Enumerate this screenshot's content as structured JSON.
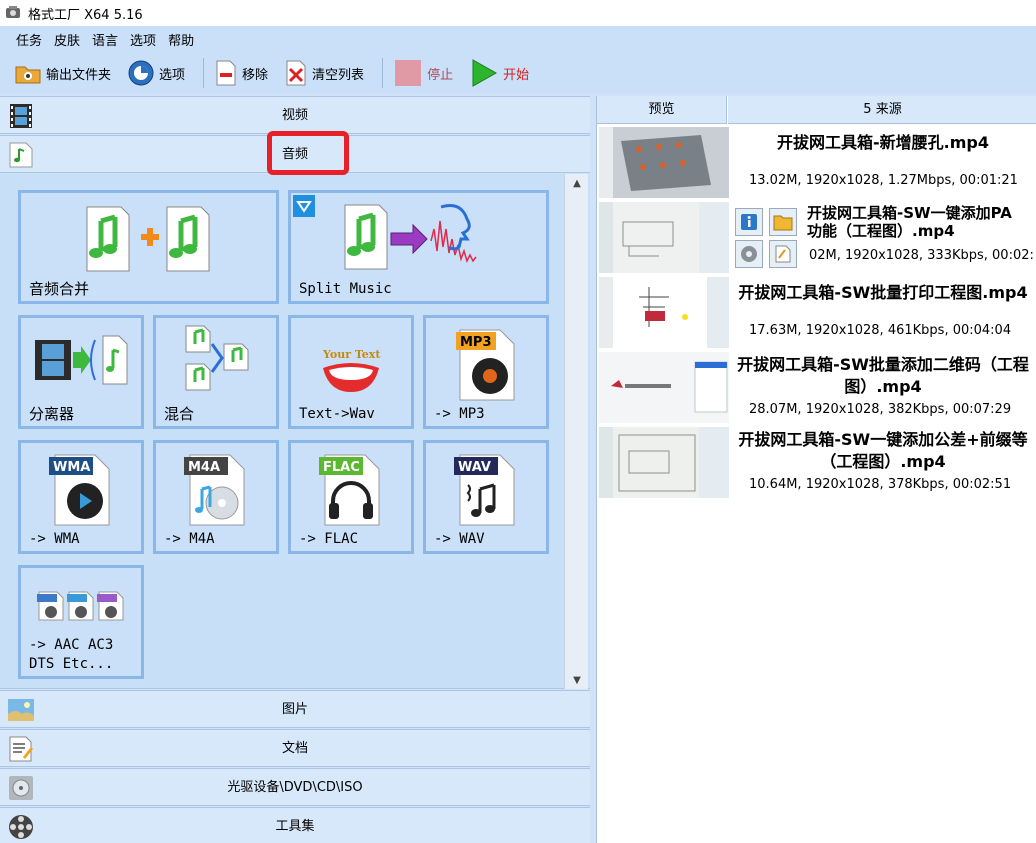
{
  "window": {
    "title": "格式工厂 X64 5.16"
  },
  "menu": [
    "任务",
    "皮肤",
    "语言",
    "选项",
    "帮助"
  ],
  "toolbar": {
    "output_folder": "输出文件夹",
    "options": "选项",
    "remove": "移除",
    "clear_list": "清空列表",
    "stop": "停止",
    "start": "开始"
  },
  "categories": {
    "video": "视频",
    "audio": "音频",
    "image": "图片",
    "document": "文档",
    "disc": "光驱设备\\DVD\\CD\\ISO",
    "tools": "工具集"
  },
  "audio_tiles": [
    {
      "label": "音频合并",
      "icon": "audio-merge-icon"
    },
    {
      "label": "Split Music",
      "icon": "split-music-icon"
    },
    {
      "label": "分离器",
      "icon": "audio-splitter-icon"
    },
    {
      "label": "混合",
      "icon": "audio-mix-icon"
    },
    {
      "label": "Text->Wav",
      "icon": "text-to-wav-icon"
    },
    {
      "label": "-> MP3",
      "icon": "mp3-icon"
    },
    {
      "label": "-> WMA",
      "icon": "wma-icon"
    },
    {
      "label": "-> M4A",
      "icon": "m4a-icon"
    },
    {
      "label": "-> FLAC",
      "icon": "flac-icon"
    },
    {
      "label": "-> WAV",
      "icon": "wav-icon"
    },
    {
      "label": "-> AAC AC3\nDTS Etc...",
      "icon": "aac-ac3-dts-icon"
    }
  ],
  "badges": {
    "mp3": "MP3",
    "wma": "WMA",
    "m4a": "M4A",
    "flac": "FLAC",
    "wav": "WAV",
    "your_text": "Your Text",
    "aac": "AAC",
    "ac3": "AC3",
    "dts": "DTS"
  },
  "right_panel": {
    "preview_header": "预览",
    "sources_header": "5 来源",
    "sources": [
      {
        "name": "开拔网工具箱-新增腰孔.mp4",
        "meta": "13.02M, 1920x1028, 1.27Mbps, 00:01:21"
      },
      {
        "name": "开拔网工具箱-SW一键添加PA\n功能（工程图）.mp4",
        "meta": "02M, 1920x1028, 333Kbps, 00:02:"
      },
      {
        "name": "开拔网工具箱-SW批量打印工程图.mp4",
        "meta": "17.63M, 1920x1028, 461Kbps, 00:04:04"
      },
      {
        "name": "开拔网工具箱-SW批量添加二维码（工程\n图）.mp4",
        "meta": "28.07M, 1920x1028, 382Kbps, 00:07:29"
      },
      {
        "name": "开拔网工具箱-SW一键添加公差+前缀等\n（工程图）.mp4",
        "meta": "10.64M, 1920x1028, 378Kbps, 00:02:51"
      }
    ]
  },
  "colors": {
    "highlight": "#e8202a",
    "tile_border": "#8ab6e8",
    "panel_bg": "#c8dff8"
  }
}
